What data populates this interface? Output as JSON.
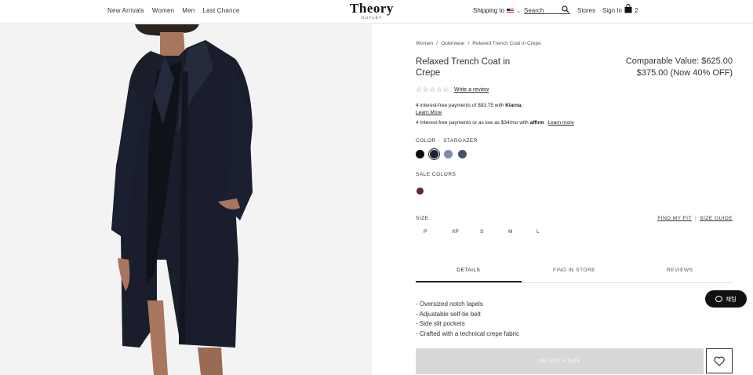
{
  "header": {
    "nav": [
      "New Arrivals",
      "Women",
      "Men",
      "Last Chance"
    ],
    "logo": "Theory",
    "logo_sub": "OUTLET",
    "shipping_label": "Shipping to",
    "search_placeholder": "Search",
    "stores": "Stores",
    "sign_in": "Sign In",
    "bag_count": "2"
  },
  "breadcrumb": [
    "Women",
    "Outerwear",
    "Relaxed Trench Coat in Crepe"
  ],
  "product": {
    "title": "Relaxed Trench Coat in Crepe",
    "comparable_value": "Comparable Value: $625.00",
    "price": "$375.00 (Now 40% OFF)",
    "stars": "☆☆☆☆☆",
    "write_review": "Write a review",
    "klarna_text": "4 interest-free payments of $93.75 with",
    "klarna_brand": "Klarna.",
    "klarna_learn": "Learn More",
    "affirm_text": "4 Interest-free payments or as low as $34/mo with",
    "affirm_brand": "affirm",
    "affirm_learn": "Learn more",
    "color_label": "COLOR -  STARGAZER",
    "colors": [
      "#0d0d0d",
      "#1e2234",
      "#7b8fa8",
      "#4a5266"
    ],
    "sale_colors_label": "SALE COLORS",
    "sale_color": "#5a2a36",
    "size_label": "SIZE",
    "find_my_fit": "FIND MY FIT",
    "size_guide": "SIZE GUIDE",
    "sizes": [
      "P",
      "XP",
      "S",
      "M",
      "L"
    ],
    "tabs": [
      "DETAILS",
      "FIND IN STORE",
      "REVIEWS"
    ],
    "details": [
      "- Oversized notch lapels",
      "- Adjustable self-tie belt",
      "- Side slit pockets",
      "- Crafted with a technical crepe fabric"
    ],
    "select_button": "SELECT A SIZE",
    "chat_label": "채팅"
  }
}
